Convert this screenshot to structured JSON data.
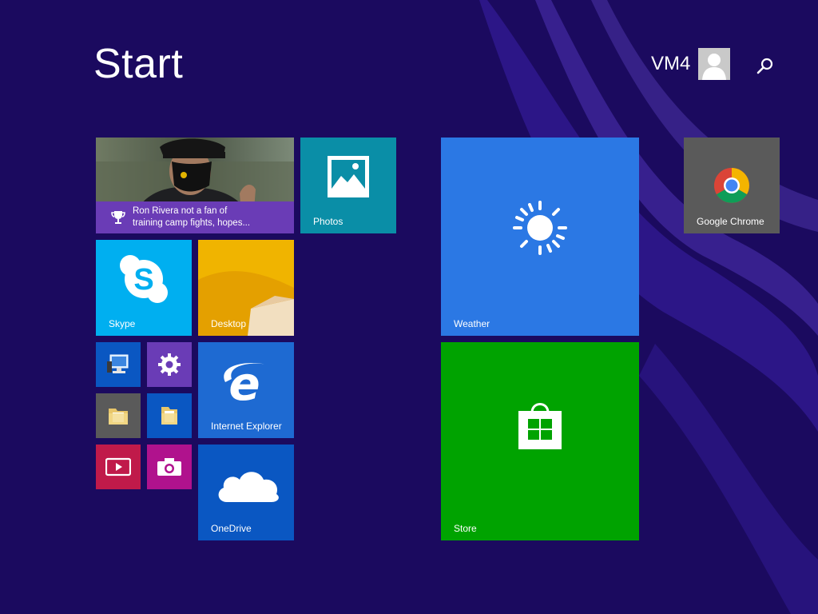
{
  "page": {
    "title": "Start"
  },
  "user": {
    "name": "VM4"
  },
  "colors": {
    "background": "#1b0a5f",
    "sports": "#6a3cb6",
    "photos": "#0a8ea7",
    "skype": "#00aff0",
    "desktop": "#e4a000",
    "weather": "#2b78e4",
    "store": "#00a300",
    "chrome": "#5a5a5a",
    "ie": "#1e6ad2",
    "onedrive": "#0a57c2"
  },
  "tiles": {
    "sports": {
      "headline_line1": "Ron Rivera not a fan of",
      "headline_line2": "training camp fights, hopes..."
    },
    "photos": {
      "label": "Photos"
    },
    "weather": {
      "label": "Weather"
    },
    "chrome": {
      "label": "Google Chrome"
    },
    "skype": {
      "label": "Skype"
    },
    "desktop": {
      "label": "Desktop"
    },
    "ie": {
      "label": "Internet Explorer"
    },
    "store": {
      "label": "Store"
    },
    "onedrive": {
      "label": "OneDrive"
    },
    "small": [
      {
        "icon": "this-pc-icon"
      },
      {
        "icon": "settings-gear-icon"
      },
      {
        "icon": "file-explorer-icon"
      },
      {
        "icon": "documents-folder-icon"
      },
      {
        "icon": "video-player-icon"
      },
      {
        "icon": "camera-icon"
      }
    ]
  }
}
